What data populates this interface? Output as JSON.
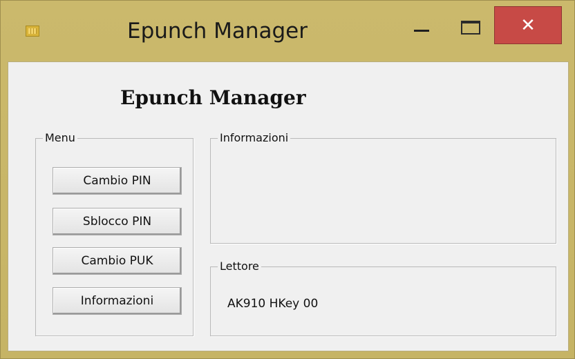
{
  "window": {
    "title": "Epunch Manager",
    "icon": "smartcard-chip-icon",
    "controls": {
      "minimize_icon": "minimize-icon",
      "maximize_icon": "maximize-icon",
      "close_glyph": "✕",
      "close_color": "#c74a46"
    },
    "frame_color": "#c9b76a"
  },
  "content": {
    "heading": "Epunch Manager",
    "menu": {
      "legend": "Menu",
      "buttons": [
        "Cambio PIN",
        "Sblocco PIN",
        "Cambio PUK",
        "Informazioni"
      ]
    },
    "info_panel": {
      "legend": "Informazioni"
    },
    "reader_panel": {
      "legend": "Lettore",
      "value": "AK910 HKey 00"
    }
  }
}
